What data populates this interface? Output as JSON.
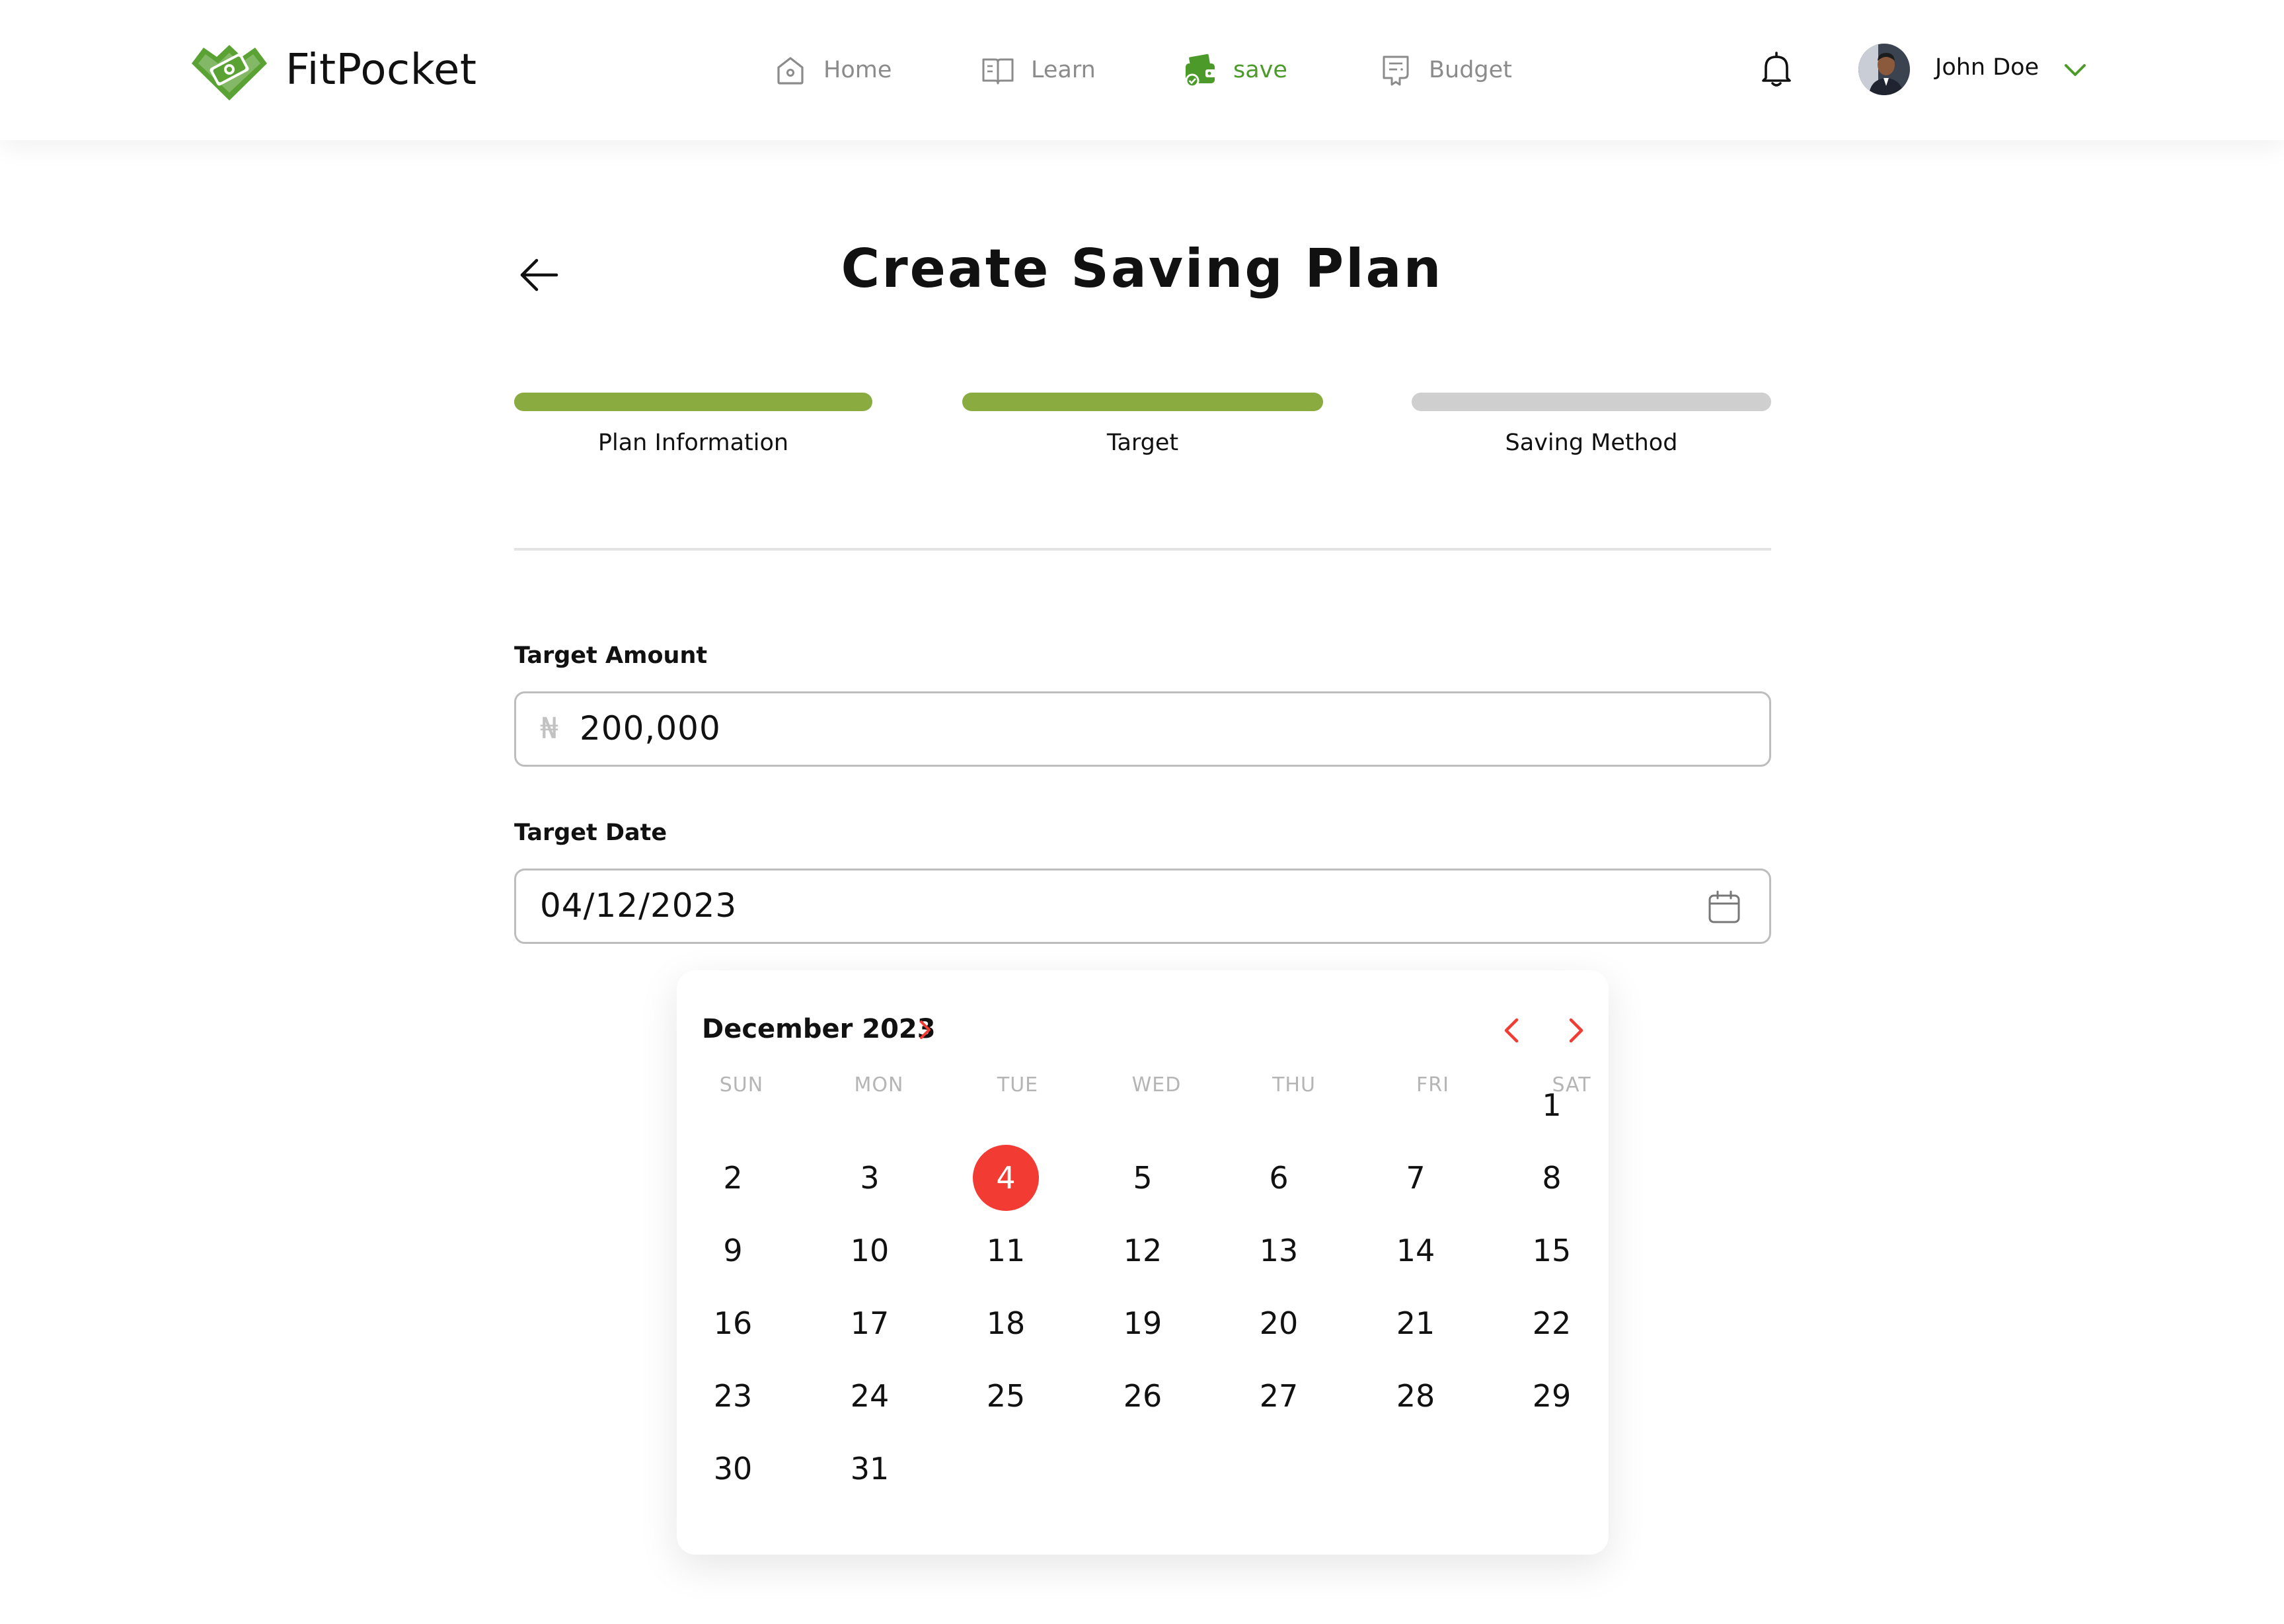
{
  "app": {
    "name": "FitPocket"
  },
  "nav": {
    "items": [
      {
        "label": "Home",
        "icon": "home-icon",
        "active": false
      },
      {
        "label": "Learn",
        "icon": "book-icon",
        "active": false
      },
      {
        "label": "save",
        "icon": "wallet-icon",
        "active": true
      },
      {
        "label": "Budget",
        "icon": "receipt-icon",
        "active": false
      }
    ]
  },
  "user": {
    "name": "John Doe"
  },
  "page": {
    "title": "Create Saving Plan"
  },
  "steps": [
    {
      "label": "Plan Information",
      "complete": true
    },
    {
      "label": "Target",
      "complete": true
    },
    {
      "label": "Saving Method",
      "complete": false
    }
  ],
  "form": {
    "target_amount": {
      "label": "Target Amount",
      "currency_symbol": "₦",
      "value": "200,000"
    },
    "target_date": {
      "label": "Target Date",
      "value": "04/12/2023"
    }
  },
  "calendar": {
    "month_label": "December 2023",
    "weekdays": [
      "SUN",
      "MON",
      "TUE",
      "WED",
      "THU",
      "FRI",
      "SAT"
    ],
    "first_weekday_index": 6,
    "days_in_month": 31,
    "selected_day": 4
  },
  "colors": {
    "brand_green": "#4c9a2a",
    "step_complete": "#8aab3f",
    "step_pending": "#cfcfcf",
    "accent_red": "#f23b33"
  }
}
